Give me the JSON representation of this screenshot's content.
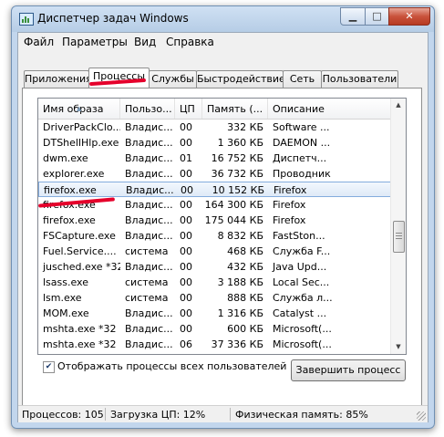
{
  "window": {
    "title": "Диспетчер задач Windows"
  },
  "menu": [
    "Файл",
    "Параметры",
    "Вид",
    "Справка"
  ],
  "tabs": [
    "Приложения",
    "Процессы",
    "Службы",
    "Быстродействие",
    "Сеть",
    "Пользователи"
  ],
  "active_tab": "Процессы",
  "columns": [
    "Имя образа",
    "Пользо...",
    "ЦП",
    "Память (...",
    "Описание"
  ],
  "rows": [
    {
      "name": "DriverPackClo...",
      "user": "Владис...",
      "cpu": "00",
      "mem": "332 КБ",
      "desc": "Software ..."
    },
    {
      "name": "DTShellHlp.exe",
      "user": "Владис...",
      "cpu": "00",
      "mem": "1 360 КБ",
      "desc": "DAEMON ..."
    },
    {
      "name": "dwm.exe",
      "user": "Владис...",
      "cpu": "01",
      "mem": "16 752 КБ",
      "desc": "Диспетч..."
    },
    {
      "name": "explorer.exe",
      "user": "Владис...",
      "cpu": "00",
      "mem": "36 732 КБ",
      "desc": "Проводник"
    },
    {
      "name": "firefox.exe",
      "user": "Владис...",
      "cpu": "00",
      "mem": "10 152 КБ",
      "desc": "Firefox"
    },
    {
      "name": "firefox.exe",
      "user": "Владис...",
      "cpu": "00",
      "mem": "164 300 КБ",
      "desc": "Firefox"
    },
    {
      "name": "firefox.exe",
      "user": "Владис...",
      "cpu": "00",
      "mem": "175 044 КБ",
      "desc": "Firefox"
    },
    {
      "name": "FSCapture.exe",
      "user": "Владис...",
      "cpu": "00",
      "mem": "8 832 КБ",
      "desc": "FastSton..."
    },
    {
      "name": "Fuel.Service....",
      "user": "система",
      "cpu": "00",
      "mem": "468 КБ",
      "desc": "Служба F..."
    },
    {
      "name": "jusched.exe *32",
      "user": "Владис...",
      "cpu": "00",
      "mem": "432 КБ",
      "desc": "Java Upd..."
    },
    {
      "name": "lsass.exe",
      "user": "система",
      "cpu": "00",
      "mem": "3 188 КБ",
      "desc": "Local Sec..."
    },
    {
      "name": "lsm.exe",
      "user": "система",
      "cpu": "00",
      "mem": "888 КБ",
      "desc": "Служба л..."
    },
    {
      "name": "MOM.exe",
      "user": "Владис...",
      "cpu": "00",
      "mem": "1 316 КБ",
      "desc": "Catalyst ..."
    },
    {
      "name": "mshta.exe *32",
      "user": "Владис...",
      "cpu": "00",
      "mem": "600 КБ",
      "desc": "Microsoft(..."
    },
    {
      "name": "mshta.exe *32",
      "user": "Владис...",
      "cpu": "06",
      "mem": "37 336 КБ",
      "desc": "Microsoft(..."
    }
  ],
  "selected_row": 4,
  "show_all_label": "Отображать процессы всех пользователей",
  "show_all_checked": true,
  "end_process_label": "Завершить процесс",
  "status": {
    "processes": "Процессов: 105",
    "cpu": "Загрузка ЦП: 12%",
    "memory": "Физическая память: 85%"
  },
  "colors": {
    "annotation": "#e5002b",
    "selection_border": "#84acdd"
  },
  "icons": {
    "close": "close-icon",
    "maximize": "maximize-icon",
    "minimize": "minimize-icon"
  }
}
